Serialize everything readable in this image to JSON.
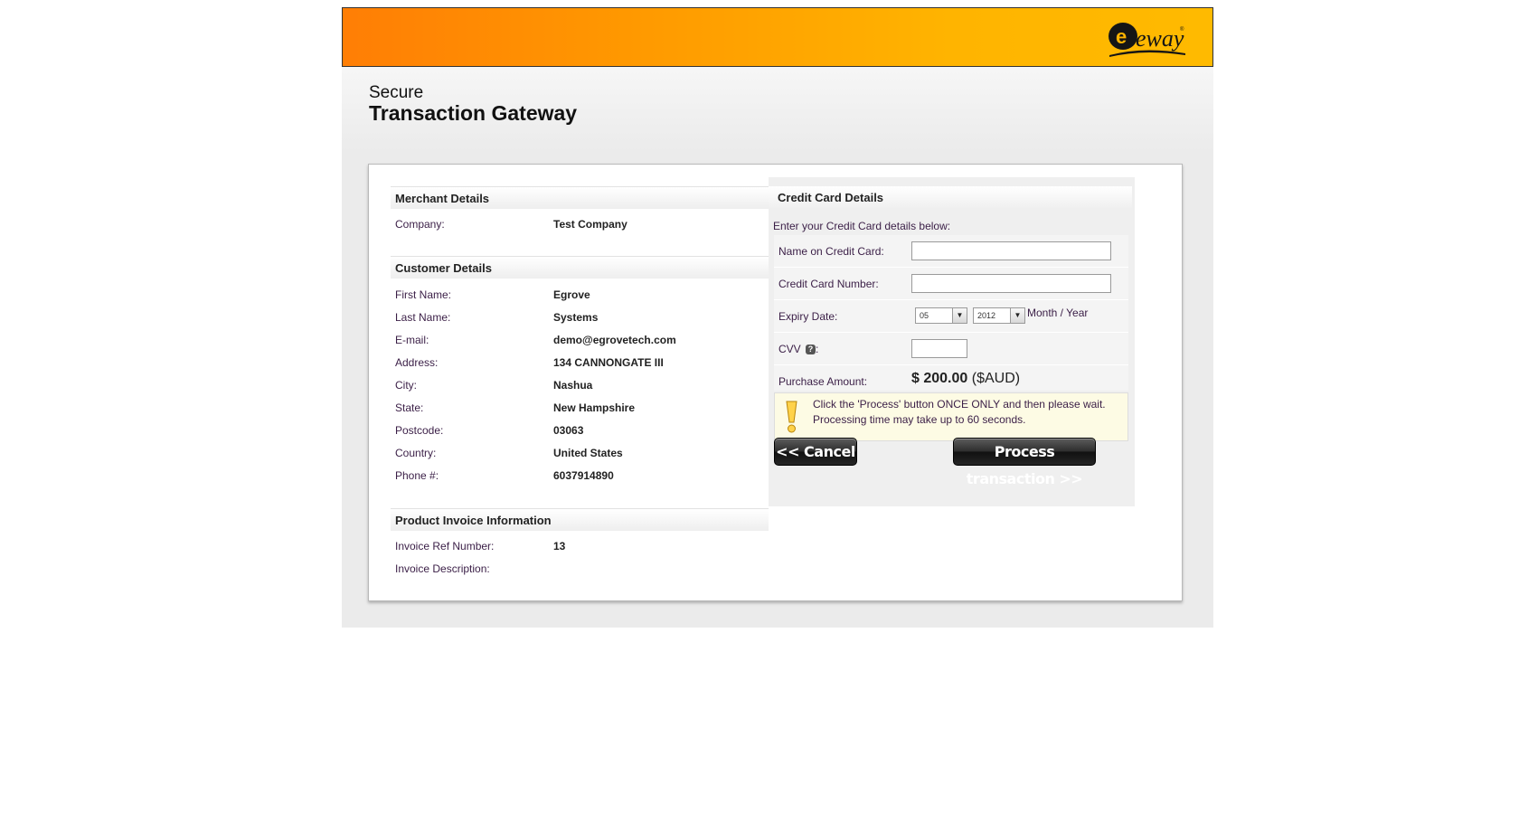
{
  "header": {
    "logo_text": "eway"
  },
  "title": {
    "line1": "Secure",
    "line2": "Transaction Gateway"
  },
  "merchant": {
    "heading": "Merchant Details",
    "rows": [
      {
        "label": "Company:",
        "value": "Test Company"
      }
    ]
  },
  "customer": {
    "heading": "Customer Details",
    "rows": [
      {
        "label": "First Name:",
        "value": "Egrove"
      },
      {
        "label": "Last Name:",
        "value": "Systems"
      },
      {
        "label": "E-mail:",
        "value": "demo@egrovetech.com"
      },
      {
        "label": "Address:",
        "value": "134 CANNONGATE III"
      },
      {
        "label": "City:",
        "value": "Nashua"
      },
      {
        "label": "State:",
        "value": "New Hampshire"
      },
      {
        "label": "Postcode:",
        "value": "03063"
      },
      {
        "label": "Country:",
        "value": "United States"
      },
      {
        "label": "Phone #:",
        "value": "6037914890"
      }
    ]
  },
  "invoice": {
    "heading": "Product Invoice Information",
    "rows": [
      {
        "label": "Invoice Ref Number:",
        "value": "13"
      },
      {
        "label": "Invoice Description:",
        "value": ""
      }
    ]
  },
  "credit_card": {
    "heading": "Credit Card Details",
    "intro": "Enter your Credit Card details below:",
    "name_label": "Name on Credit Card:",
    "name_value": "",
    "number_label": "Credit Card Number:",
    "number_value": "",
    "expiry_label": "Expiry Date:",
    "expiry_month": "05",
    "expiry_year": "2012",
    "expiry_hint": "Month / Year",
    "cvv_label": "CVV",
    "cvv_colon": ":",
    "cvv_value": "",
    "amount_label": "Purchase Amount:",
    "amount_value": "$ 200.00",
    "amount_currency": "($AUD)",
    "notice_line1": "Click the 'Process' button ONCE ONLY and then please wait.",
    "notice_line2": "Processing time may take up to 60 seconds.",
    "cancel_label": "<< Cancel",
    "process_label": "Process transaction >>"
  },
  "colors": {
    "header_start": "#ff7e05",
    "header_end": "#ffba00",
    "label_text": "#3a1e46"
  },
  "icons": [
    "eway-logo",
    "help-icon",
    "warning-exclamation-icon",
    "dropdown-arrow-icon"
  ]
}
